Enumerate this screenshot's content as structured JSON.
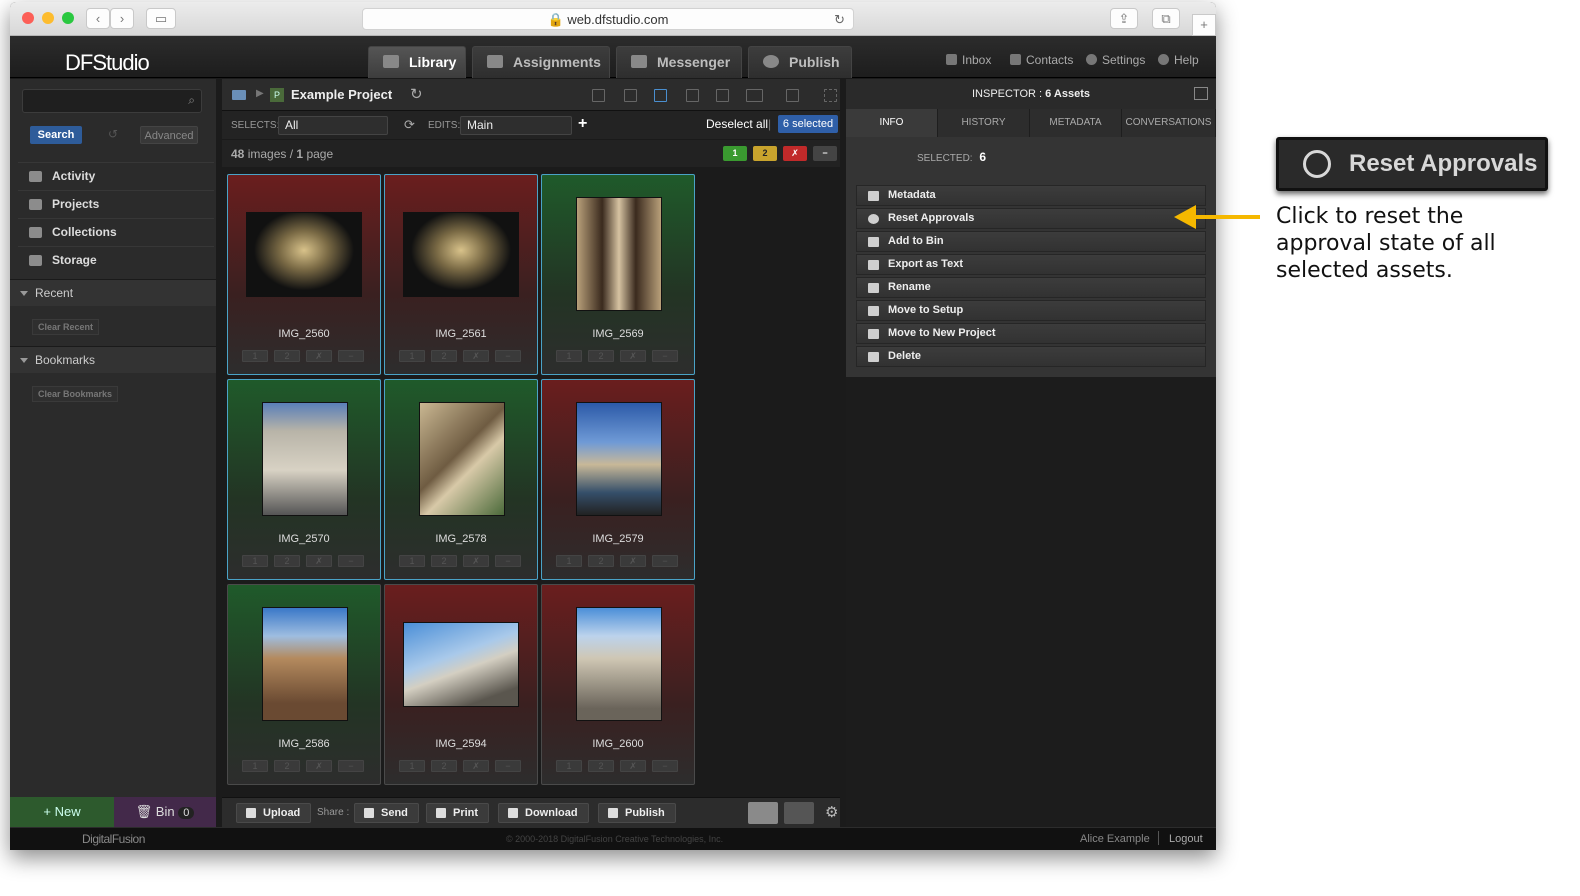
{
  "browser": {
    "url": "web.dfstudio.com"
  },
  "header": {
    "logo": "DFStudio",
    "tabs": [
      {
        "label": "Library"
      },
      {
        "label": "Assignments"
      },
      {
        "label": "Messenger"
      },
      {
        "label": "Publish"
      }
    ],
    "links": {
      "inbox": "Inbox",
      "contacts": "Contacts",
      "settings": "Settings",
      "help": "Help"
    }
  },
  "sidebar": {
    "search_label": "Search",
    "advanced_label": "Advanced",
    "items": [
      {
        "label": "Activity"
      },
      {
        "label": "Projects"
      },
      {
        "label": "Collections"
      },
      {
        "label": "Storage"
      }
    ],
    "recent": {
      "label": "Recent",
      "clear": "Clear Recent"
    },
    "bookmarks": {
      "label": "Bookmarks",
      "clear": "Clear Bookmarks"
    },
    "new_label": "New",
    "bin_label": "Bin",
    "bin_count": "0"
  },
  "center": {
    "project_badge": "P",
    "project_title": "Example Project",
    "selects_label": "SELECTS:",
    "selects_value": "All",
    "edits_label": "EDITS:",
    "edits_value": "Main",
    "deselect_all": "Deselect all",
    "separator": "|",
    "selected_count": "6 selected",
    "image_count": "48",
    "images_word": "images",
    "slash": "/",
    "page_count": "1",
    "page_word": "page",
    "flags": {
      "one": "1",
      "two": "2",
      "reject": "✗",
      "none": "−"
    },
    "rating_buttons": {
      "one": "1",
      "two": "2",
      "reject": "✗",
      "none": "−"
    },
    "assets": [
      {
        "name": "IMG_2560",
        "state": "red",
        "selected": true
      },
      {
        "name": "IMG_2561",
        "state": "red",
        "selected": true
      },
      {
        "name": "IMG_2569",
        "state": "green",
        "selected": true
      },
      {
        "name": "IMG_2570",
        "state": "green",
        "selected": true
      },
      {
        "name": "IMG_2578",
        "state": "green",
        "selected": true
      },
      {
        "name": "IMG_2579",
        "state": "red",
        "selected": true
      },
      {
        "name": "IMG_2586",
        "state": "green",
        "selected": false
      },
      {
        "name": "IMG_2594",
        "state": "red",
        "selected": false
      },
      {
        "name": "IMG_2600",
        "state": "red",
        "selected": false
      }
    ],
    "bottom": {
      "upload": "Upload",
      "share": "Share :",
      "send": "Send",
      "print": "Print",
      "download": "Download",
      "publish": "Publish"
    }
  },
  "inspector": {
    "title": "INSPECTOR :",
    "assets_count": "6 Assets",
    "tabs": [
      {
        "label": "INFO"
      },
      {
        "label": "HISTORY"
      },
      {
        "label": "METADATA"
      },
      {
        "label": "CONVERSATIONS"
      }
    ],
    "selected_label": "SELECTED:",
    "selected_value": "6",
    "actions": [
      {
        "label": "Metadata"
      },
      {
        "label": "Reset Approvals"
      },
      {
        "label": "Add to Bin"
      },
      {
        "label": "Export as Text"
      },
      {
        "label": "Rename"
      },
      {
        "label": "Move to Setup"
      },
      {
        "label": "Move to New Project"
      },
      {
        "label": "Delete"
      }
    ]
  },
  "footer": {
    "brand": "DigitalFusion",
    "copyright": "© 2000-2018 DigitalFusion Creative Technologies, Inc.",
    "user": "Alice Example",
    "logout": "Logout"
  },
  "annotation": {
    "callout": "Reset Approvals",
    "note": "Click to reset the approval state of all selected assets."
  },
  "colors": {
    "approved": "#1f5a2a",
    "rejected": "#6a1e1e",
    "selection_blue": "#2f5fa8",
    "arrow": "#f5b800"
  }
}
